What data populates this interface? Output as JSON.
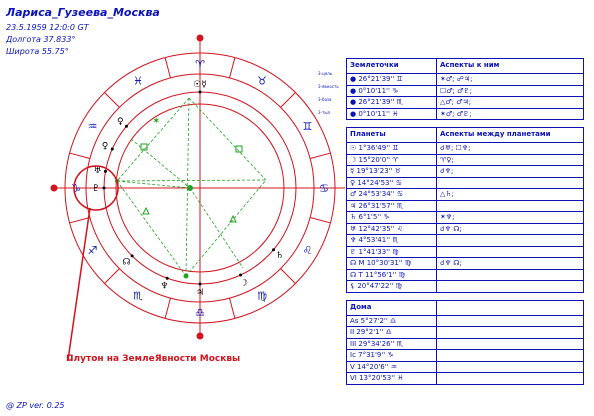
{
  "header": {
    "title": "Лариса_Гузеева_Москва",
    "datetime": "23.5.1959 12:0:0 GT",
    "longitude": "Долгота 37.833°",
    "latitude": "Широта 55.75°"
  },
  "footer": "@ ZP  ver. 0.25",
  "callout": "Плутон на ЗемлеЯвности Москвы",
  "side_labels": [
    "3-цель",
    "3-явность",
    "3-база",
    "3-тыл"
  ],
  "colors": {
    "ink": "#0a12b8",
    "red": "#d2141e",
    "green": "#1fa51f"
  },
  "earth_points": {
    "headers": [
      "Землеточки",
      "Аспекты к ним"
    ],
    "rows": [
      [
        "● 26°21'39'' ♊",
        "✶♂; ☍♃;"
      ],
      [
        "● 0°10'11'' ♑",
        "☐♂; ♂♇;"
      ],
      [
        "● 26°21'39'' ♏",
        "△♂; ♂♃;"
      ],
      [
        "● 0°10'11'' ♓",
        "✶♂; ♂♇;"
      ]
    ]
  },
  "planets": {
    "headers": [
      "Планеты",
      "Аспекты между планетами"
    ],
    "rows": [
      [
        "☉ 1°36'49'' ♊",
        "☌♅; ☐♆;"
      ],
      [
        "☽ 15°20'0'' ♈",
        "♈♀;"
      ],
      [
        "☿ 19°13'23'' ♉",
        "☌♆;"
      ],
      [
        "♀ 14°24'53'' ♋",
        ""
      ],
      [
        "♂ 24°53'34'' ♋",
        "△♄;"
      ],
      [
        "♃ 26°31'57'' ♏",
        ""
      ],
      [
        "♄ 6°1'5'' ♑",
        "✶♆;"
      ],
      [
        "♅ 12°42'35'' ♌",
        "☌♆ ☊;"
      ],
      [
        "♆ 4°53'41'' ♏",
        ""
      ],
      [
        "♇ 1°41'33'' ♍",
        ""
      ],
      [
        "☊ M 10°30'31'' ♍",
        "☌♆ ☊;"
      ],
      [
        "☊ T 11°56'1'' ♍",
        ""
      ],
      [
        "⚸ 20°47'22'' ♍",
        ""
      ]
    ]
  },
  "houses": {
    "headers": [
      "Дома",
      ""
    ],
    "rows": [
      [
        "As 5°27'2'' ♎",
        ""
      ],
      [
        "II 29°2'1'' ♎",
        ""
      ],
      [
        "III 29°34'26'' ♏",
        ""
      ],
      [
        "Ic 7°31'9'' ♑",
        ""
      ],
      [
        "V 14°20'6'' ♒",
        ""
      ],
      [
        "VI 13°20'53'' ♓",
        ""
      ]
    ]
  },
  "wheel": {
    "zodiac_glyphs": [
      "♉",
      "♈",
      "♓",
      "♒",
      "♑",
      "♐",
      "♏",
      "♎",
      "♍",
      "♌",
      "♋",
      "♊"
    ],
    "planet_marks": [
      {
        "glyph": "☉☿",
        "deg": 90
      },
      {
        "glyph": "♀",
        "deg": 140
      },
      {
        "glyph": "♀",
        "deg": 156
      },
      {
        "glyph": "♅",
        "deg": 170
      },
      {
        "glyph": "♇",
        "deg": 180
      },
      {
        "glyph": "☊",
        "deg": 225
      },
      {
        "glyph": "♆",
        "deg": 250
      },
      {
        "glyph": "♃",
        "deg": 270
      },
      {
        "glyph": "☽",
        "deg": 295
      },
      {
        "glyph": "♄",
        "deg": 320
      }
    ]
  }
}
